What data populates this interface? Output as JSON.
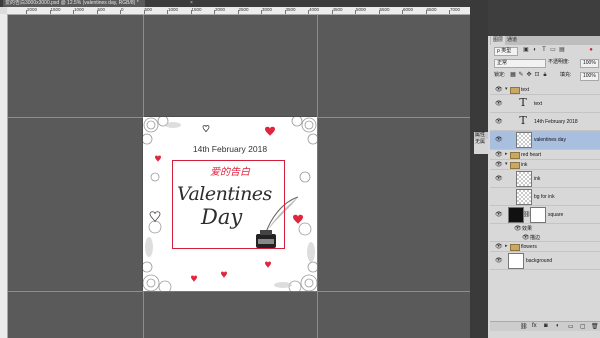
{
  "document": {
    "tab_title": "爱的告白3000x3000.psd @ 12.5% (valentines day, RGB/8) *",
    "close": "×"
  },
  "ruler": {
    "ticks": [
      "2000",
      "1500",
      "1000",
      "500",
      "0",
      "500",
      "1000",
      "1500",
      "2000",
      "2500",
      "3000",
      "3500",
      "4000",
      "4500",
      "5000",
      "5500",
      "6000",
      "6500",
      "7000",
      "7500"
    ]
  },
  "artwork": {
    "date": "14th February 2018",
    "chinese_title": "爱的告白",
    "valentines": "Valentines",
    "day": "Day",
    "accent_color": "#d21f3c"
  },
  "properties_mini": {
    "label1": "属性",
    "label2": "无属"
  },
  "layers_panel": {
    "tabs": [
      "图层",
      "通道"
    ],
    "kind_filter": "ρ 类型",
    "blend_mode": "正常",
    "opacity_label": "不透明度:",
    "opacity_value": "100%",
    "lock_label": "锁定:",
    "fill_label": "填充:",
    "fill_value": "100%",
    "layers": [
      {
        "name": "text",
        "kind": "group",
        "visible": true,
        "expanded": true
      },
      {
        "name": "text",
        "kind": "text",
        "visible": true
      },
      {
        "name": "14th February 2018",
        "kind": "text",
        "visible": true
      },
      {
        "name": "valentines day",
        "kind": "smart",
        "visible": true,
        "selected": true
      },
      {
        "name": "red heart",
        "kind": "group",
        "visible": true,
        "expanded": false
      },
      {
        "name": "ink",
        "kind": "group",
        "visible": true,
        "expanded": true
      },
      {
        "name": "ink",
        "kind": "pixel",
        "visible": true
      },
      {
        "name": "bg for ink",
        "kind": "pixel",
        "visible": false
      },
      {
        "name": "square",
        "kind": "shape",
        "visible": true
      },
      {
        "name": "效果",
        "kind": "effect",
        "visible": true
      },
      {
        "name": "描边",
        "kind": "effect",
        "visible": true
      },
      {
        "name": "flowers",
        "kind": "group",
        "visible": true,
        "expanded": false
      },
      {
        "name": "background",
        "kind": "pixel",
        "visible": true
      }
    ],
    "bottom_icons": [
      "link-icon",
      "fx",
      "mask-icon",
      "adjust-icon",
      "folder-icon",
      "new-icon",
      "trash-icon"
    ]
  }
}
